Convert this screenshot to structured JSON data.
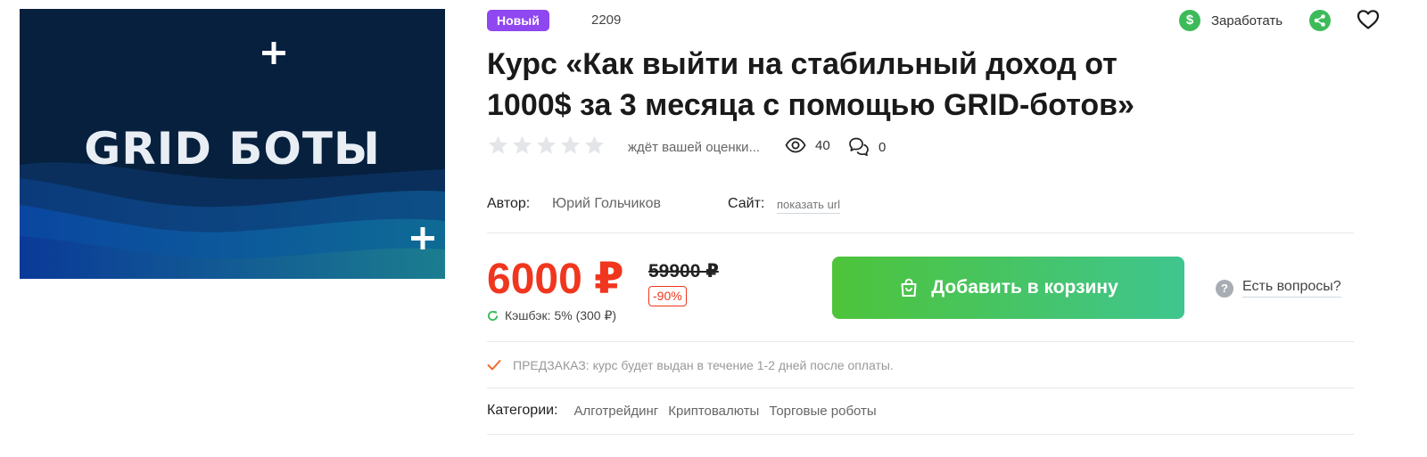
{
  "banner": {
    "title": "GRID БОТЫ"
  },
  "product": {
    "badge": "Новый",
    "id": "2209",
    "title": "Курс «Как выйти на стабильный доход от 1000$ за 3 месяца с помощью GRID-ботов»",
    "rating_hint": "ждёт вашей оценки...",
    "views": "40",
    "comments": "0"
  },
  "actions": {
    "earn_label": "Заработать",
    "earn_icon_glyph": "$"
  },
  "meta": {
    "author_label": "Автор:",
    "author_name": "Юрий Гольчиков",
    "site_label": "Сайт:",
    "site_link": "показать url"
  },
  "pricing": {
    "price": "6000 ₽",
    "old_price": "59900 ₽",
    "discount": "-90%",
    "cashback": "Кэшбэк: 5% (300 ₽)"
  },
  "cart": {
    "label": "Добавить в корзину"
  },
  "questions": {
    "label": "Есть вопросы?",
    "icon_glyph": "?"
  },
  "preorder": {
    "text": "ПРЕДЗАКАЗ: курс будет выдан в течение 1-2 дней после оплаты."
  },
  "categories": {
    "label": "Категории:",
    "items": [
      "Алготрейдинг",
      "Криптовалюты",
      "Торговые роботы"
    ]
  },
  "colors": {
    "badge": "#8f47f0",
    "price": "#f0361e",
    "cart_start": "#4ec43a",
    "cart_end": "#3fc58f",
    "accent_green": "#3dbb5a",
    "banner_bg": "#06203d"
  }
}
